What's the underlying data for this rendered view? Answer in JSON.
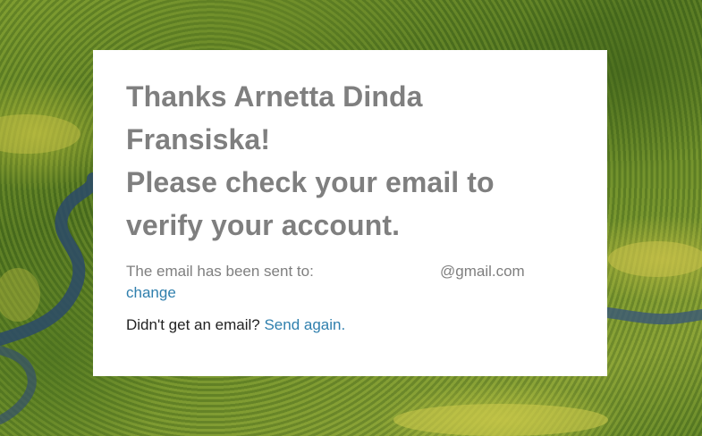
{
  "background": {
    "description_icon": "rainforest-river-photo"
  },
  "card": {
    "heading_line1": "Thanks Arnetta Dinda",
    "heading_line2": "Fransiska!",
    "heading_line3": "Please check your email to",
    "heading_line4": "verify your account.",
    "sent_label": "The email has been sent to:",
    "sent_email": "@gmail.com",
    "change_label": "change",
    "resend_prompt": "Didn't get an email?",
    "send_again_label": "Send again."
  },
  "colors": {
    "heading": "#7f7f7f",
    "link": "#2f7fad",
    "card_background": "#ffffff"
  }
}
